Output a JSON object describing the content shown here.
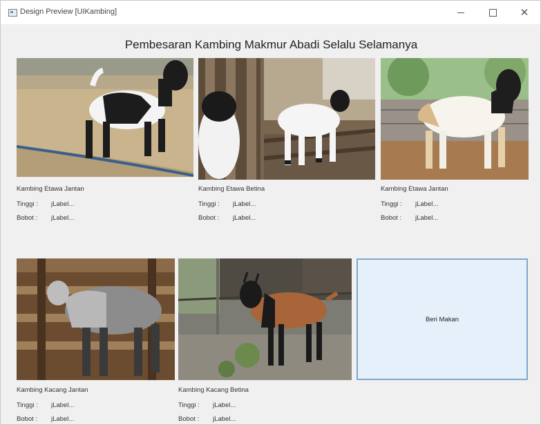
{
  "window": {
    "title": "Design Preview [UIKambing]",
    "minimize_icon": "minimize-icon",
    "maximize_icon": "maximize-icon",
    "close_icon": "close-icon"
  },
  "heading": "Pembesaran Kambing Makmur Abadi Selalu Selamanya",
  "labels": {
    "height_key": "Tinggi :",
    "weight_key": "Bobot :"
  },
  "cards": [
    {
      "name": "Kambing Etawa Jantan",
      "height": "jLabel...",
      "weight": "jLabel..."
    },
    {
      "name": "Kambing Etawa Betina",
      "height": "jLabel...",
      "weight": "jLabel..."
    },
    {
      "name": "Kambing Etawa Jantan",
      "height": "jLabel...",
      "weight": "jLabel..."
    },
    {
      "name": "Kambing Kacang Jantan",
      "height": "jLabel...",
      "weight": "jLabel..."
    },
    {
      "name": "Kambing Kacang Betina",
      "height": "jLabel...",
      "weight": "jLabel..."
    }
  ],
  "feed_button": {
    "label": "Beri Makan"
  },
  "colors": {
    "button_bg": "#e6f0fa",
    "button_border": "#7ea7cf"
  }
}
